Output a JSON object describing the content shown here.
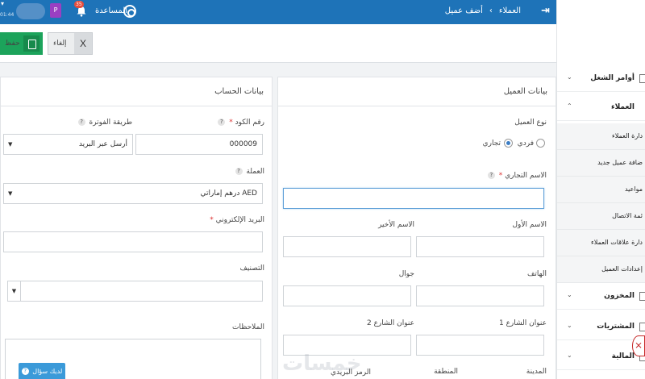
{
  "topbar": {
    "time": "01:44",
    "user_initial": "P",
    "notifications_count": "35",
    "help_label": "المساعدة",
    "breadcrumb_parent": "العملاء",
    "breadcrumb_separator": "›",
    "breadcrumb_current": "أضف عميل",
    "accent_color": "#1e73b8"
  },
  "actions": {
    "save_label": "حفظ",
    "cancel_label": "إلغاء",
    "cancel_icon": "X"
  },
  "account_panel": {
    "title": "بيانات الحساب",
    "code_label": "رقم الكود",
    "code_value": "000009",
    "invoice_method_label": "طريقة الفوترة",
    "invoice_method_value": "أرسل عبر البريد",
    "currency_label": "العملة",
    "currency_value": "AED درهم إماراتي",
    "email_label": "البريد الإلكتروني",
    "email_value": "",
    "category_label": "التصنيف",
    "category_value": "",
    "notes_label": "الملاحظات",
    "ask_label": "لديك سؤال"
  },
  "client_panel": {
    "title": "بيانات العميل",
    "client_type_label": "نوع العميل",
    "type_individual": "فردي",
    "type_business": "تجاري",
    "selected_type": "تجاري",
    "business_name_label": "الاسم التجاري",
    "first_name_label": "الاسم الأول",
    "last_name_label": "الاسم الأخير",
    "phone_label": "الهاتف",
    "mobile_label": "جوال",
    "street1_label": "عنوان الشارع 1",
    "street2_label": "عنوان الشارع 2",
    "city_label": "المدينة",
    "region_label": "المنطقة",
    "postal_label": "الرمز البريدي"
  },
  "sidebar": {
    "work_orders": "أوامر الشغل",
    "clients": "العملاء",
    "sub_items": [
      "دارة العملاء",
      "ضافة عميل جديد",
      "مواعيد",
      "ئمة الاتصال",
      "دارة علاقات العملاء",
      "إعدادات العميل"
    ],
    "inventory": "المخزون",
    "purchases": "المشتريات",
    "finance": "المالية"
  },
  "watermark": "خمسات"
}
